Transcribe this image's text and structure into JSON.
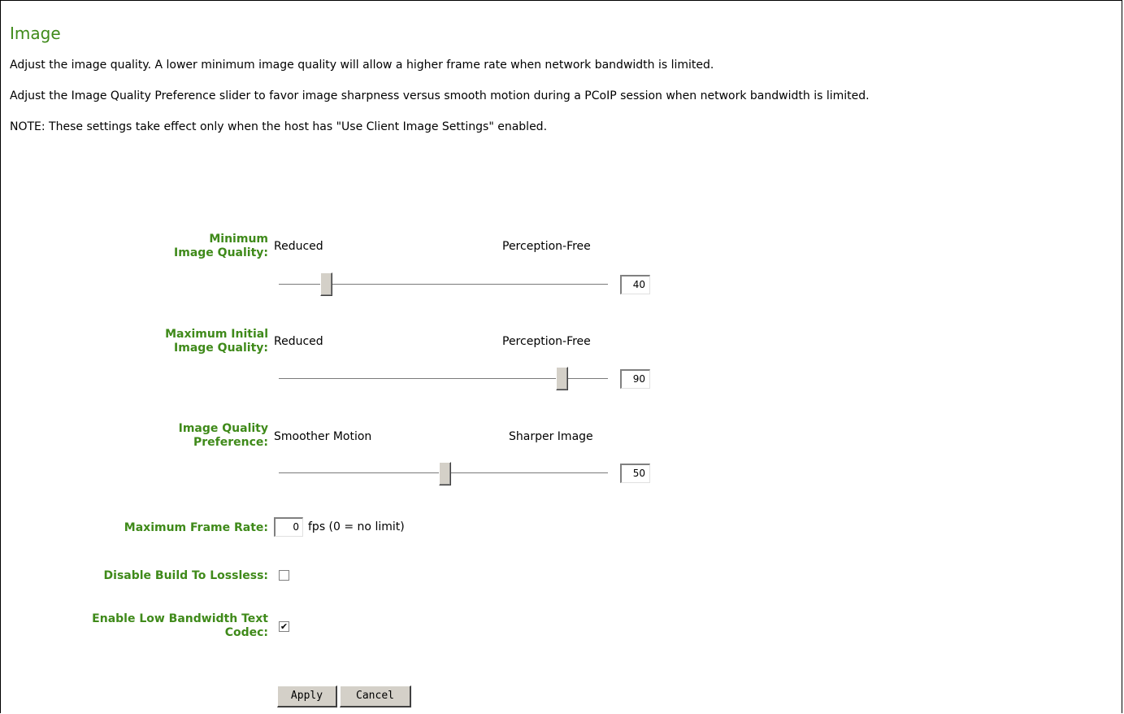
{
  "page": {
    "title": "Image",
    "paragraphs": [
      "Adjust the image quality. A lower minimum image quality will allow a higher frame rate when network bandwidth is limited.",
      "Adjust the Image Quality Preference slider to favor image sharpness versus smooth motion during a PCoIP session when network bandwidth is limited.",
      "NOTE: These settings take effect only when the host has \"Use Client Image Settings\" enabled."
    ]
  },
  "sliders": [
    {
      "label_line1": "Minimum",
      "label_line2": "Image Quality:",
      "left_text": "Reduced",
      "right_text": "Perception-Free",
      "value": "40"
    },
    {
      "label_line1": "Maximum Initial",
      "label_line2": "Image Quality:",
      "left_text": "Reduced",
      "right_text": "Perception-Free",
      "value": "90"
    },
    {
      "label_line1": "Image Quality",
      "label_line2": "Preference:",
      "left_text": "Smoother Motion",
      "right_text": "Sharper Image",
      "value": "50"
    }
  ],
  "frame_rate": {
    "label": "Maximum Frame Rate:",
    "value": "0",
    "suffix": "fps (0 = no limit)"
  },
  "disable_build": {
    "label": "Disable Build To Lossless:",
    "checked": false
  },
  "low_bandwidth": {
    "label_line1": "Enable Low Bandwidth Text",
    "label_line2": "Codec:",
    "checked": true,
    "mark": "✔"
  },
  "buttons": {
    "apply": "Apply",
    "cancel": "Cancel"
  },
  "colors": {
    "label_green": "#3f8a1a"
  }
}
